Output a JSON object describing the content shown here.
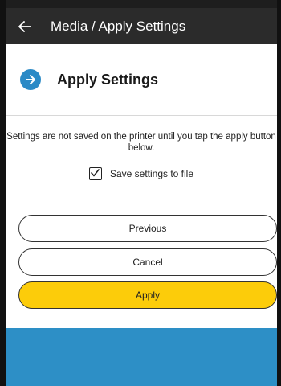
{
  "appbar": {
    "title": "Media / Apply Settings",
    "back_icon": "arrow-left-icon"
  },
  "section": {
    "icon": "arrow-right-circle-icon",
    "title": "Apply Settings"
  },
  "info_text": "Settings are not saved on the printer until you tap the apply button below.",
  "save_option": {
    "label": "Save settings to file",
    "checked": true
  },
  "buttons": {
    "previous": "Previous",
    "cancel": "Cancel",
    "apply": "Apply"
  },
  "colors": {
    "appbar": "#2b2b2b",
    "accent_blue": "#2b8ac6",
    "apply_yellow": "#fccc0a",
    "bottom_band": "#2d8fc6"
  }
}
